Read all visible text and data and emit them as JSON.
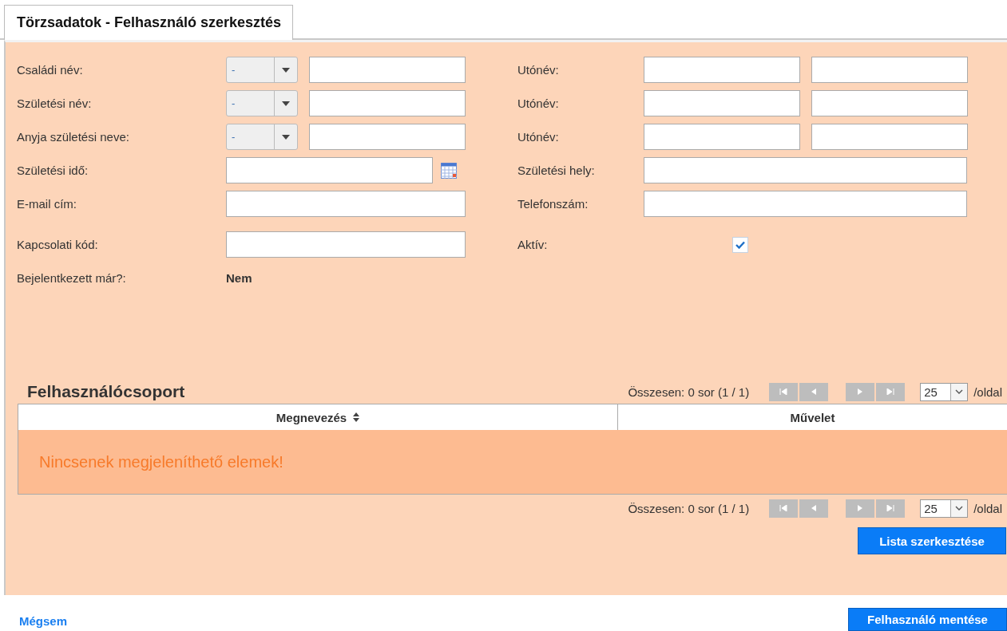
{
  "tab": {
    "label": "Törzsadatok - Felhasználó szerkesztés",
    "selected": true
  },
  "form_rows": [
    {
      "left": {
        "label": "Családi név:",
        "kind": "select_text",
        "select_value": "-"
      },
      "right": {
        "label": "Utónév:",
        "kind": "two_text"
      }
    },
    {
      "left": {
        "label": "Születési név:",
        "kind": "select_text",
        "select_value": "-"
      },
      "right": {
        "label": "Utónév:",
        "kind": "two_text"
      }
    },
    {
      "left": {
        "label": "Anyja születési neve:",
        "kind": "select_text",
        "select_value": "-"
      },
      "right": {
        "label": "Utónév:",
        "kind": "two_text"
      }
    },
    {
      "left": {
        "label": "Születési idő:",
        "kind": "date"
      },
      "right": {
        "label": "Születési hely:",
        "kind": "text"
      }
    },
    {
      "left": {
        "label": "E-mail cím:",
        "kind": "text"
      },
      "right": {
        "label": "Telefonszám:",
        "kind": "text"
      }
    },
    {
      "left": {
        "label": "Kapcsolati kód:",
        "kind": "text"
      },
      "right": {
        "label": "Aktív:",
        "kind": "checkbox",
        "checked": true
      }
    },
    {
      "left": {
        "label": "Bejelentkezett már?:",
        "kind": "value",
        "value": "Nem"
      }
    }
  ],
  "group_table": {
    "title": "Felhasználócsoport",
    "pagers": [
      {
        "summary": "Összesen: 0 sor (1 / 1)",
        "page_size": "25",
        "per_page": "/oldal"
      },
      {
        "summary": "Összesen: 0 sor (1 / 1)",
        "page_size": "25",
        "per_page": "/oldal"
      }
    ],
    "columns": [
      {
        "label": "Megnevezés",
        "sortable": true
      },
      {
        "label": "Művelet",
        "sortable": false
      }
    ],
    "empty_message": "Nincsenek megjeleníthető elemek!",
    "edit_button": "Lista szerkesztése"
  },
  "cancel_link": "Mégsem",
  "save_button": "Felhasználó mentése"
}
